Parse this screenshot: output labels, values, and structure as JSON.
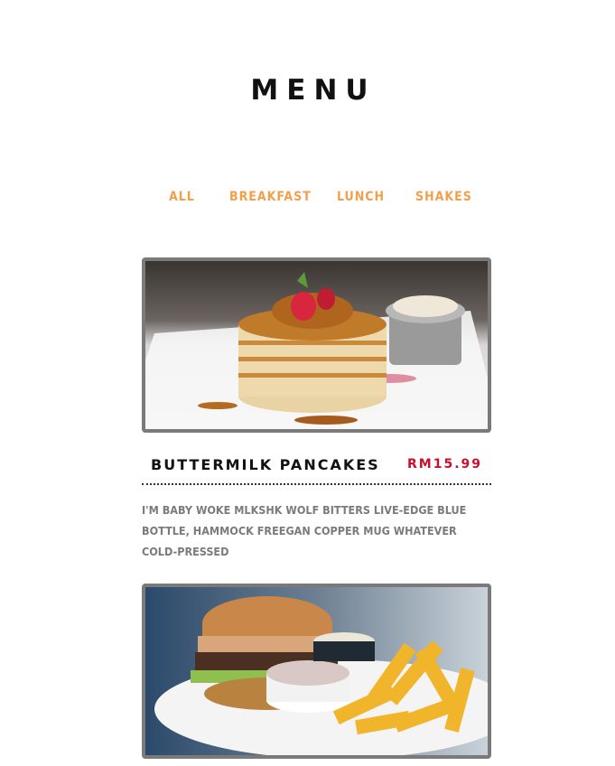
{
  "page": {
    "title": "MENU"
  },
  "filters": [
    {
      "label": "ALL"
    },
    {
      "label": "BREAKFAST"
    },
    {
      "label": "LUNCH"
    },
    {
      "label": "SHAKES"
    }
  ],
  "items": [
    {
      "name": "BUTTERMILK PANCAKES",
      "price": "RM15.99",
      "description": "I'M BABY WOKE MLKSHK WOLF BITTERS LIVE-EDGE BLUE BOTTLE, HAMMOCK FREEGAN COPPER MUG WHATEVER COLD-PRESSED",
      "image": "pancakes-photo"
    },
    {
      "image": "burger-fries-photo"
    }
  ],
  "colors": {
    "filter": "#f0a04b",
    "price": "#c8102e",
    "description": "#7b7b7b",
    "card_border": "#7a7a7a"
  }
}
